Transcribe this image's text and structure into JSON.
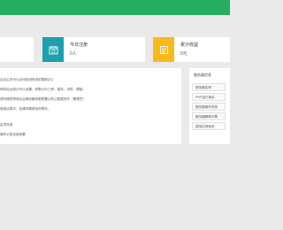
{
  "colors": {
    "header": "#27ad62",
    "teal_icon": "#1e9fac",
    "gold_icon": "#f8b91a",
    "background": "#eaeaea"
  },
  "cards": [
    {
      "title": "",
      "value": ""
    },
    {
      "title": "今日注册",
      "value": "0人",
      "icon": "calendar-icon"
    },
    {
      "title": "累计收益",
      "value": "0元",
      "icon": "wallet-icon"
    }
  ],
  "notice": {
    "lines": [
      "后台主页可以自动检测系统的更新(已)",
      "修改后台统计可以设置，参数分为三种：保存、浏览、模板。",
      "请勿随意修改后台服务器参数配置以防止数据丢失（管理员）",
      "使用过程中，如遇问题请及时联系。",
      "会员信息",
      "操作记录全部查看"
    ]
  },
  "sidebar": {
    "title": "服务器信息",
    "items": [
      "服务器名称",
      "PHP运行版本",
      "服务器操作系统",
      "服务器解释引擎",
      "虚拟空间版本"
    ]
  }
}
